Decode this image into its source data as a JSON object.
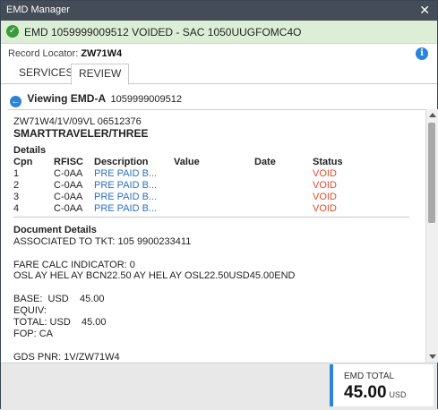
{
  "window": {
    "title": "EMD Manager",
    "close_glyph": "✕"
  },
  "banner": {
    "message": "EMD  1059999009512 VOIDED - SAC 1050UUGFOMC4O",
    "icon": "check-circle-icon"
  },
  "record": {
    "label": "Record Locator:",
    "value": "ZW71W4"
  },
  "tabs": [
    {
      "label": "SERVICES"
    },
    {
      "label": "REVIEW"
    }
  ],
  "viewing": {
    "label": "Viewing EMD-A",
    "number": "1059999009512"
  },
  "emd": {
    "ref_line": "ZW71W4/1V/09VL 06512376",
    "passenger": "SMARTTRAVELER/THREE",
    "details_title": "Details",
    "columns": {
      "cpn": "Cpn",
      "rfisc": "RFISC",
      "description": "Description",
      "value": "Value",
      "date": "Date",
      "status": "Status"
    },
    "rows": [
      {
        "cpn": "1",
        "rfisc": "C-0AA",
        "description": "PRE PAID B...",
        "value": "",
        "date": "",
        "status": "VOID"
      },
      {
        "cpn": "2",
        "rfisc": "C-0AA",
        "description": "PRE PAID B...",
        "value": "",
        "date": "",
        "status": "VOID"
      },
      {
        "cpn": "3",
        "rfisc": "C-0AA",
        "description": "PRE PAID B...",
        "value": "",
        "date": "",
        "status": "VOID"
      },
      {
        "cpn": "4",
        "rfisc": "C-0AA",
        "description": "PRE PAID B...",
        "value": "",
        "date": "",
        "status": "VOID"
      }
    ],
    "doc_title": "Document Details",
    "associated": "ASSOCIATED TO TKT:  105 9900233411",
    "fare_calc": "FARE CALC INDICATOR: 0",
    "fare_line": "OSL AY HEL AY BCN22.50 AY HEL AY OSL22.50USD45.00END",
    "base": "BASE:  USD    45.00",
    "equiv": "EQUIV:",
    "total": "TOTAL: USD    45.00",
    "fop": "FOP: CA",
    "gds": "GDS PNR: 1V/ZW71W4"
  },
  "footer": {
    "label": "EMD TOTAL",
    "amount": "45.00",
    "currency": "USD"
  },
  "colors": {
    "accent": "#2b84d8",
    "void": "#e24b2b",
    "banner_bg": "#dcefd6",
    "titlebar": "#434c57"
  }
}
